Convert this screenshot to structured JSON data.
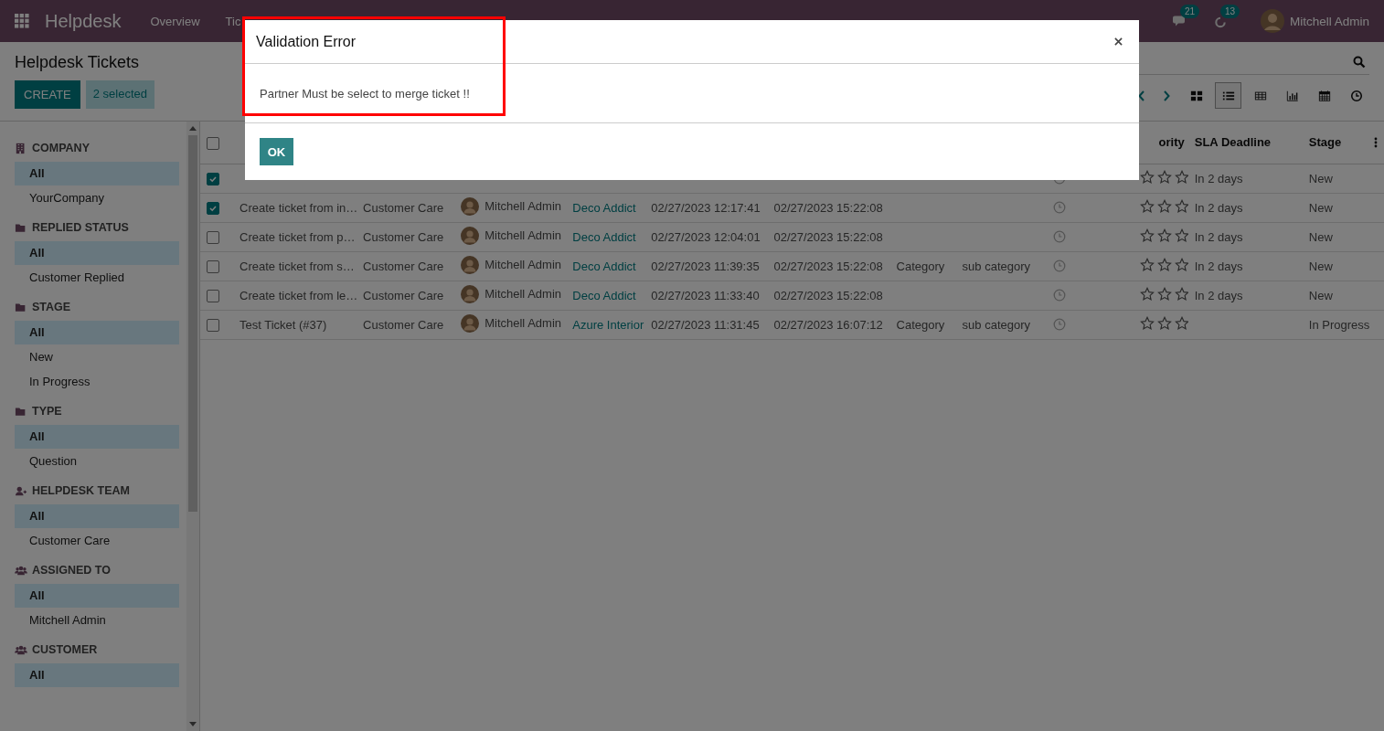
{
  "navbar": {
    "app": "Helpdesk",
    "menu": [
      "Overview",
      "Tic"
    ],
    "messages_badge": "21",
    "activities_badge": "13",
    "user": "Mitchell Admin"
  },
  "control_panel": {
    "title": "Helpdesk Tickets",
    "create_button": "CREATE",
    "selection": "2 selected",
    "views": [
      {
        "kind": "kanban",
        "selected": false
      },
      {
        "kind": "list",
        "selected": true
      },
      {
        "kind": "pivot",
        "selected": false
      },
      {
        "kind": "graph",
        "selected": false
      },
      {
        "kind": "calendar",
        "selected": false
      },
      {
        "kind": "activity",
        "selected": false
      }
    ]
  },
  "sidebar": {
    "sections": [
      {
        "kind": "company",
        "title": "COMPANY",
        "items": [
          {
            "label": "All",
            "selected": true
          },
          {
            "label": "YourCompany",
            "selected": false
          }
        ]
      },
      {
        "kind": "folder",
        "title": "REPLIED STATUS",
        "items": [
          {
            "label": "All",
            "selected": true
          },
          {
            "label": "Customer Replied",
            "selected": false
          }
        ]
      },
      {
        "kind": "folder",
        "title": "STAGE",
        "items": [
          {
            "label": "All",
            "selected": true
          },
          {
            "label": "New",
            "selected": false
          },
          {
            "label": "In Progress",
            "selected": false
          }
        ]
      },
      {
        "kind": "folder",
        "title": "TYPE",
        "items": [
          {
            "label": "All",
            "selected": true
          },
          {
            "label": "Question",
            "selected": false
          }
        ]
      },
      {
        "kind": "team",
        "title": "HELPDESK TEAM",
        "items": [
          {
            "label": "All",
            "selected": true
          },
          {
            "label": "Customer Care",
            "selected": false
          }
        ]
      },
      {
        "kind": "users",
        "title": "ASSIGNED TO",
        "items": [
          {
            "label": "All",
            "selected": true
          },
          {
            "label": "Mitchell Admin",
            "selected": false
          }
        ]
      },
      {
        "kind": "users",
        "title": "CUSTOMER",
        "items": [
          {
            "label": "All",
            "selected": true
          }
        ]
      }
    ]
  },
  "table": {
    "header": {
      "checked": false,
      "priority": "ority",
      "sla_deadline": "SLA Deadline",
      "stage": "Stage"
    },
    "rows": [
      {
        "checked": true,
        "stars": 0,
        "sla": "In 2 days",
        "stage": "New"
      },
      {
        "checked": true,
        "name": "Create ticket from in…",
        "team": "Customer Care",
        "assigned": "Mitchell Admin",
        "customer": "Deco Addict",
        "created": "02/27/2023 12:17:41",
        "deadline": "02/27/2023 15:22:08",
        "stars": 0,
        "sla": "In 2 days",
        "stage": "New"
      },
      {
        "checked": false,
        "name": "Create ticket from p…",
        "team": "Customer Care",
        "assigned": "Mitchell Admin",
        "customer": "Deco Addict",
        "created": "02/27/2023 12:04:01",
        "deadline": "02/27/2023 15:22:08",
        "stars": 0,
        "sla": "In 2 days",
        "stage": "New"
      },
      {
        "checked": false,
        "name": "Create ticket from s…",
        "team": "Customer Care",
        "assigned": "Mitchell Admin",
        "customer": "Deco Addict",
        "created": "02/27/2023 11:39:35",
        "deadline": "02/27/2023 15:22:08",
        "category": "Category",
        "subcategory": "sub category",
        "stars": 0,
        "sla": "In 2 days",
        "stage": "New"
      },
      {
        "checked": false,
        "name": "Create ticket from le…",
        "team": "Customer Care",
        "assigned": "Mitchell Admin",
        "customer": "Deco Addict",
        "created": "02/27/2023 11:33:40",
        "deadline": "02/27/2023 15:22:08",
        "stars": 0,
        "sla": "In 2 days",
        "stage": "New"
      },
      {
        "checked": false,
        "name": "Test Ticket (#37)",
        "team": "Customer Care",
        "assigned": "Mitchell Admin",
        "customer": "Azure Interior",
        "created": "02/27/2023 11:31:45",
        "deadline": "02/27/2023 16:07:12",
        "category": "Category",
        "subcategory": "sub category",
        "stars": 0,
        "stage": "In Progress"
      }
    ]
  },
  "dialog": {
    "title": "Validation Error",
    "message": "Partner Must be select to merge ticket !!",
    "button": "OK"
  }
}
